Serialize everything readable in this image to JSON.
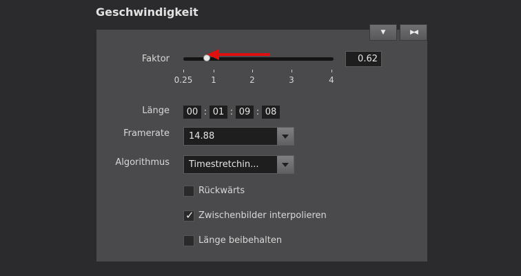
{
  "panel_title": "Geschwindigkeit",
  "header_buttons": [
    {
      "icon": "triangle-down-icon",
      "glyph": "▼"
    },
    {
      "icon": "collapse-arrows-icon",
      "glyph": "▶◀"
    }
  ],
  "factor": {
    "label": "Faktor",
    "value": "0.62",
    "slider_fraction": 0.1,
    "ticks": [
      "0.25",
      "1",
      "2",
      "3",
      "4"
    ]
  },
  "length": {
    "label": "Länge",
    "segments": [
      "00",
      "01",
      "09",
      "08"
    ],
    "separator": ":"
  },
  "framerate": {
    "label": "Framerate",
    "value": "14.88"
  },
  "algorithm": {
    "label": "Algorithmus",
    "value": "Timestretchin..."
  },
  "checkboxes": [
    {
      "label": "Rückwärts",
      "checked": false
    },
    {
      "label": "Zwischenbilder interpolieren",
      "checked": true
    },
    {
      "label": "Länge beibehalten",
      "checked": false
    }
  ],
  "annotation_color": "#e01010"
}
